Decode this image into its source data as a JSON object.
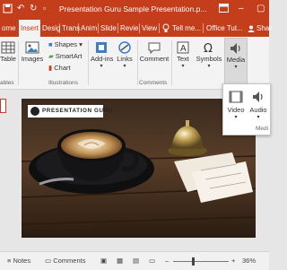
{
  "titlebar": {
    "title": "Presentation Guru Sample Presentation.p...",
    "minimize": "–",
    "restore": "▢"
  },
  "tabs": [
    {
      "label": "ome"
    },
    {
      "label": "Insert"
    },
    {
      "label": "Desig"
    },
    {
      "label": "Trans"
    },
    {
      "label": "Anim"
    },
    {
      "label": "Slide"
    },
    {
      "label": "Revie"
    },
    {
      "label": "View"
    },
    {
      "label": "Tell me..."
    },
    {
      "label": "Office Tut..."
    }
  ],
  "ribbon": {
    "table": "Table",
    "tables_group": "ables",
    "images": "Images",
    "shapes": "Shapes",
    "smartart": "SmartArt",
    "chart": "Chart",
    "illustrations_group": "Illustrations",
    "addins": "Add-ins",
    "links": "Links",
    "comment": "Comment",
    "comments_group": "Comments",
    "text": "Text",
    "symbols": "Symbols",
    "media": "Media",
    "media_group": "Medi"
  },
  "share": "Shar",
  "media_dropdown": {
    "video": "Video",
    "audio": "Audio"
  },
  "slide": {
    "logo_text": "PRESENTATION GURU"
  },
  "statusbar": {
    "notes": "Notes",
    "comments": "Comments",
    "zoom": "36%"
  },
  "colors": {
    "accent": "#c43e1c",
    "ribbon_bg": "#f3f3f3"
  }
}
